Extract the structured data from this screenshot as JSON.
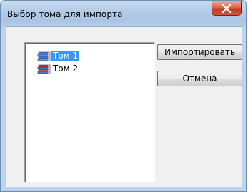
{
  "window": {
    "title": "Выбор тома для импорта"
  },
  "tree": {
    "items": [
      {
        "label": "Том 1",
        "icon": "books-icon",
        "selected": true
      },
      {
        "label": "Том 2",
        "icon": "books-icon",
        "selected": false
      }
    ]
  },
  "buttons": {
    "import_label": "Импортировать",
    "cancel_label": "Отмена"
  },
  "colors": {
    "selection": "#3399ff",
    "close_button": "#c2391f",
    "frame": "#b5cde8"
  }
}
